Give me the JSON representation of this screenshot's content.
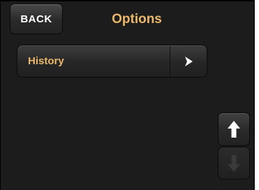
{
  "header": {
    "back_label": "BACK",
    "title": "Options"
  },
  "menu": {
    "items": [
      {
        "label": "History",
        "arrow_icon": "chevron-right-icon"
      }
    ]
  },
  "scroll": {
    "up_icon": "arrow-up-icon",
    "down_icon": "arrow-down-icon",
    "down_enabled": false
  },
  "colors": {
    "accent": "#e8b76a",
    "background": "#1c1c1c",
    "disabled_icon": "#3a3a3a"
  }
}
